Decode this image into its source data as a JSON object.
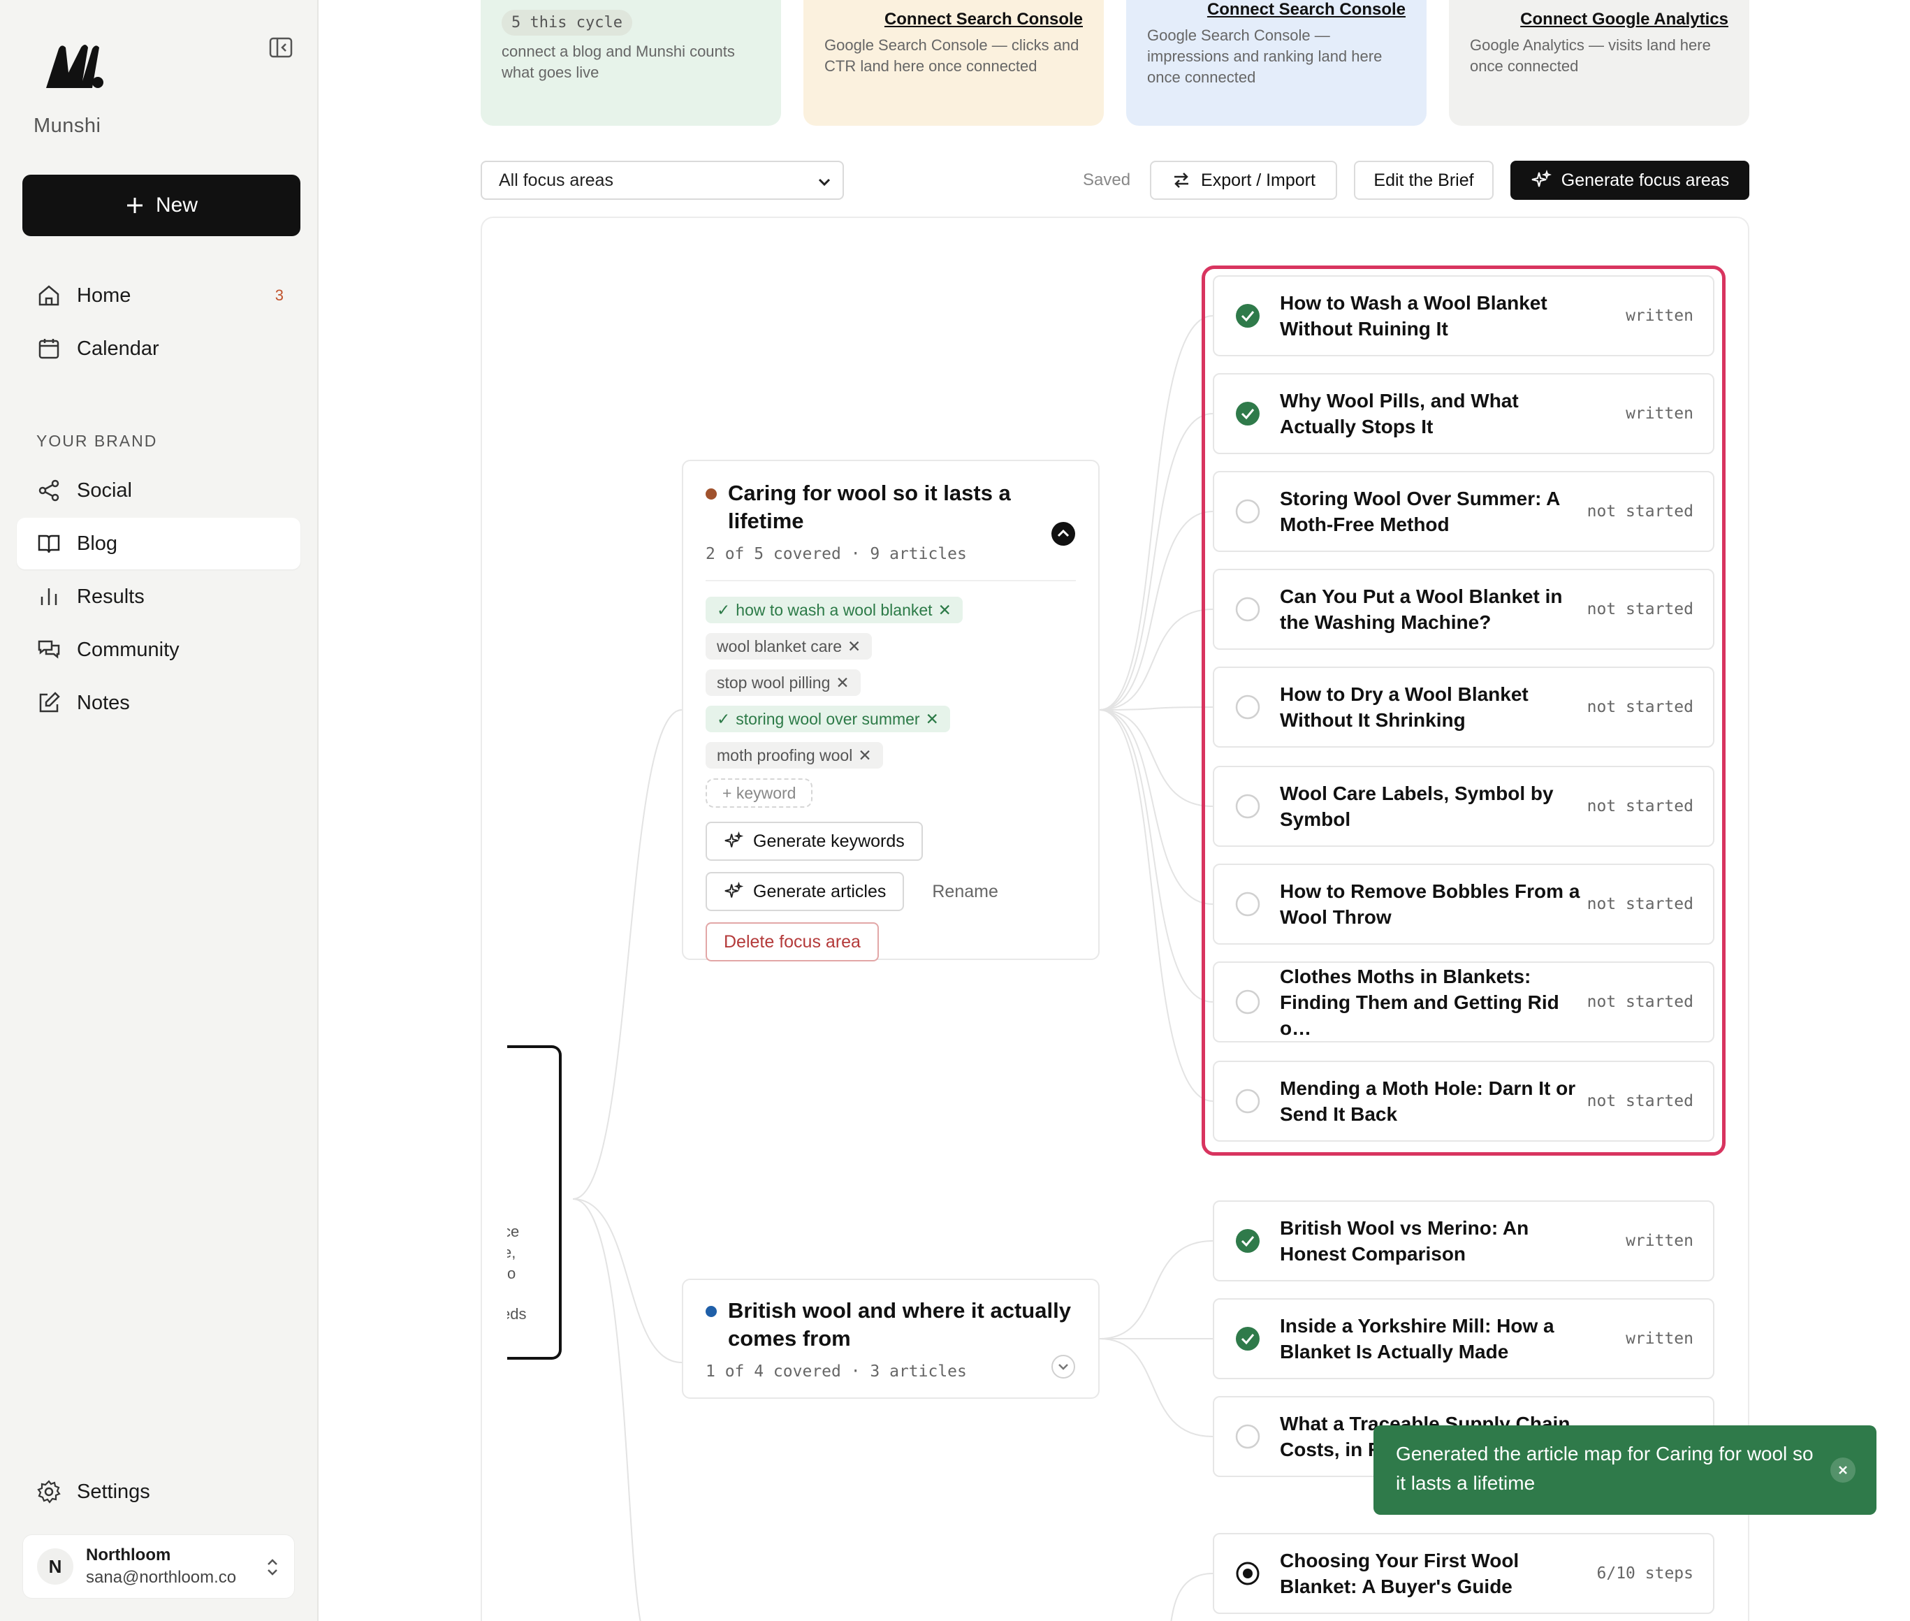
{
  "app": {
    "brand": "Munshi"
  },
  "sidebar": {
    "new_label": "New",
    "items": [
      {
        "label": "Home",
        "badge": "3"
      },
      {
        "label": "Calendar"
      }
    ],
    "section_label": "YOUR BRAND",
    "brand_items": [
      {
        "label": "Social"
      },
      {
        "label": "Blog"
      },
      {
        "label": "Results"
      },
      {
        "label": "Community"
      },
      {
        "label": "Notes"
      }
    ],
    "settings_label": "Settings",
    "account": {
      "initial": "N",
      "name": "Northloom",
      "email": "sana@northloom.co"
    }
  },
  "top_cards": [
    {
      "pill": "5 this cycle",
      "desc": "connect a blog and Munshi counts what goes live",
      "bg": "#e7f3ea"
    },
    {
      "link": "Connect Search Console",
      "desc": "Google Search Console — clicks and CTR land here once connected",
      "bg": "#fbf1de"
    },
    {
      "link": "Connect Search Console",
      "desc": "Google Search Console — impressions and ranking land here once connected",
      "bg": "#e4edfa"
    },
    {
      "link": "Connect Google Analytics",
      "desc": "Google Analytics — visits land here once connected",
      "bg": "#f1f1ef"
    }
  ],
  "toolbar": {
    "filter_value": "All focus areas",
    "saved": "Saved",
    "export_label": "Export / Import",
    "brief_label": "Edit the Brief",
    "generate_label": "Generate focus areas"
  },
  "root_node": {
    "lines": [
      "ce",
      "e,",
      "o",
      "eds"
    ]
  },
  "focus_areas": [
    {
      "title": "Caring for wool so it lasts a lifetime",
      "dot_color": "#a0522d",
      "meta": "2 of 5 covered · 9 articles",
      "keywords": [
        {
          "text": "how to wash a wool blanket",
          "covered": true
        },
        {
          "text": "wool blanket care",
          "covered": false
        },
        {
          "text": "stop wool pilling",
          "covered": false
        },
        {
          "text": "storing wool over summer",
          "covered": true
        },
        {
          "text": "moth proofing wool",
          "covered": false
        }
      ],
      "add_keyword": "+ keyword",
      "generate_keywords": "Generate keywords",
      "generate_articles": "Generate articles",
      "rename": "Rename",
      "delete": "Delete focus area"
    },
    {
      "title": "British wool and where it actually comes from",
      "dot_color": "#1f5fa8",
      "meta": "1 of 4 covered · 3 articles"
    }
  ],
  "articles_group_1": [
    {
      "title": "How to Wash a Wool Blanket Without Ruining It",
      "state": "written",
      "status": "written"
    },
    {
      "title": "Why Wool Pills, and What Actually Stops It",
      "state": "written",
      "status": "written"
    },
    {
      "title": "Storing Wool Over Summer: A Moth-Free Method",
      "state": "not started",
      "status": "open"
    },
    {
      "title": "Can You Put a Wool Blanket in the Washing Machine?",
      "state": "not started",
      "status": "open"
    },
    {
      "title": "How to Dry a Wool Blanket Without It Shrinking",
      "state": "not started",
      "status": "open"
    },
    {
      "title": "Wool Care Labels, Symbol by Symbol",
      "state": "not started",
      "status": "open"
    },
    {
      "title": "How to Remove Bobbles From a Wool Throw",
      "state": "not started",
      "status": "open"
    },
    {
      "title": "Clothes Moths in Blankets: Finding Them and Getting Rid o…",
      "state": "not started",
      "status": "open"
    },
    {
      "title": "Mending a Moth Hole: Darn It or Send It Back",
      "state": "not started",
      "status": "open"
    }
  ],
  "articles_group_2": [
    {
      "title": "British Wool vs Merino: An Honest Comparison",
      "state": "written",
      "status": "written"
    },
    {
      "title": "Inside a Yorkshire Mill: How a Blanket Is Actually Made",
      "state": "written",
      "status": "written"
    },
    {
      "title": "What a Traceable Supply Chain Costs, in Re",
      "state": "",
      "status": "open"
    },
    {
      "title": "Choosing Your First Wool Blanket: A Buyer's Guide",
      "state": "6/10 steps",
      "status": "progress"
    }
  ],
  "toast": {
    "message": "Generated the article map for Caring for wool so it lasts a lifetime"
  }
}
